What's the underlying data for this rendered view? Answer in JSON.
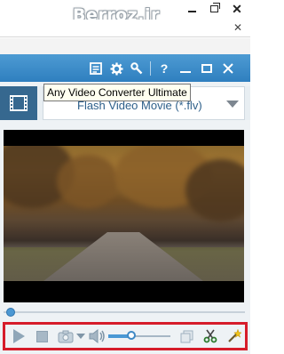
{
  "outer": {
    "watermark": "Berroz.ir",
    "controls": [
      "minimize-icon",
      "maximize-icon",
      "close-icon"
    ]
  },
  "app": {
    "title_buttons": [
      "profile-icon",
      "settings-icon",
      "tools-icon",
      "help-icon",
      "minimize-icon",
      "maximize-icon",
      "close-icon"
    ],
    "help_label": "?",
    "tooltip": "Any Video Converter Ultimate",
    "format": {
      "selected": "Flash Video Movie (*.flv)",
      "icon": "film-strip-icon"
    }
  },
  "playback": {
    "seek_position": 0.01,
    "volume_level": 0.35
  },
  "colors": {
    "accent": "#4a98d4",
    "highlight": "#d61c2a",
    "titlebar": "#3a8ac8"
  }
}
